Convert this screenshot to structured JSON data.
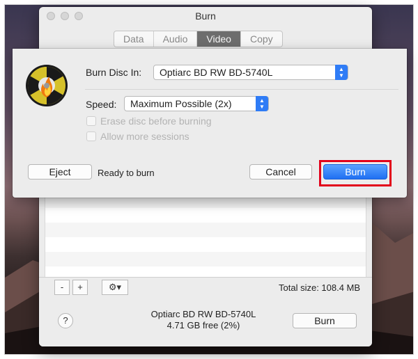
{
  "window": {
    "title": "Burn",
    "tabs": [
      {
        "label": "Data",
        "active": false
      },
      {
        "label": "Audio",
        "active": false
      },
      {
        "label": "Video",
        "active": true
      },
      {
        "label": "Copy",
        "active": false
      }
    ]
  },
  "sheet": {
    "burn_disc_label": "Burn Disc In:",
    "burn_disc_value": "Optiarc BD RW BD-5740L",
    "speed_label": "Speed:",
    "speed_value": "Maximum Possible (2x)",
    "erase_label": "Erase disc before burning",
    "sessions_label": "Allow more sessions",
    "eject_label": "Eject",
    "status": "Ready to burn",
    "cancel_label": "Cancel",
    "burn_label": "Burn"
  },
  "bottom": {
    "minus_label": "-",
    "plus_label": "+",
    "gear_icon": "gear-icon",
    "total_size": "Total size: 108.4 MB",
    "help_label": "?",
    "drive_name": "Optiarc BD RW BD-5740L",
    "drive_free": "4.71 GB free (2%)",
    "burn_label": "Burn"
  },
  "colors": {
    "accent": "#2f7cf6",
    "highlight": "#e2001a"
  }
}
